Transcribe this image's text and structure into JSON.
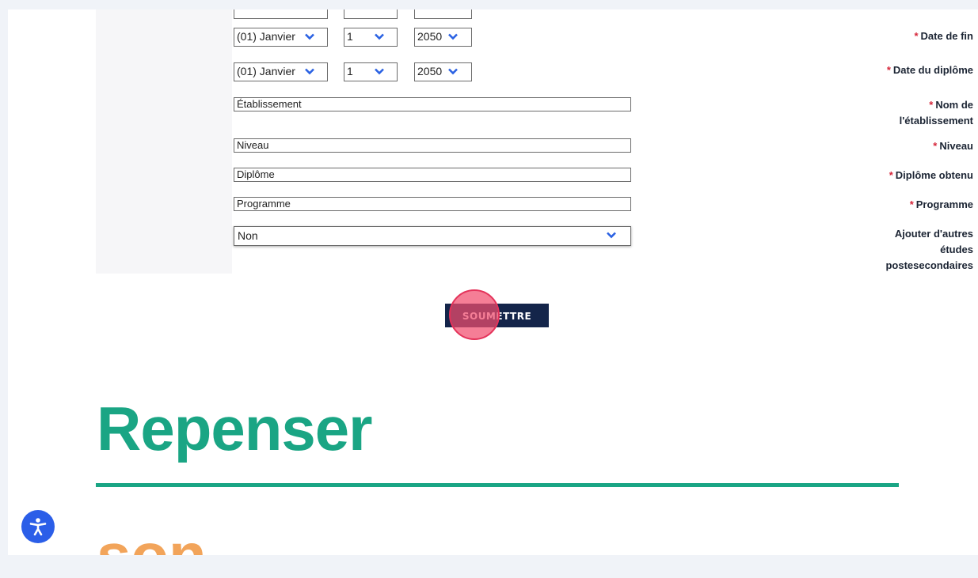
{
  "form": {
    "start_date": {
      "month": "",
      "day": "",
      "year": ""
    },
    "end_date": {
      "label": "Date de fin",
      "month": "(01) Janvier",
      "day": "1",
      "year": "2050"
    },
    "diploma_date": {
      "label": "Date du diplôme",
      "month": "(01) Janvier",
      "day": "1",
      "year": "2050"
    },
    "institution": {
      "label": "Nom de l'établissement",
      "label_line1": "Nom de",
      "label_line2": "l'établissement",
      "value": "Établissement"
    },
    "level": {
      "label": "Niveau",
      "value": "Niveau"
    },
    "diploma": {
      "label": "Diplôme obtenu",
      "value": "Diplôme"
    },
    "program": {
      "label": "Programme",
      "value": "Programme"
    },
    "more_studies": {
      "label_line1": "Ajouter d'autres",
      "label_line2": "études",
      "label_line3": "postesecondaires",
      "value": "Non"
    },
    "required_marker": "*",
    "submit_label": "SOUMETTRE"
  },
  "content": {
    "headline": "Repenser",
    "subheadline": "son"
  },
  "colors": {
    "accent_green": "#1aa584",
    "accent_orange": "#f2a45a",
    "button_navy": "#14254a",
    "chevron_blue": "#2b62e3",
    "required_red": "#d6263a",
    "click_highlight": "#f14c6e"
  },
  "icons": {
    "dropdown": "chevron-down-icon",
    "accessibility": "accessibility-icon"
  }
}
